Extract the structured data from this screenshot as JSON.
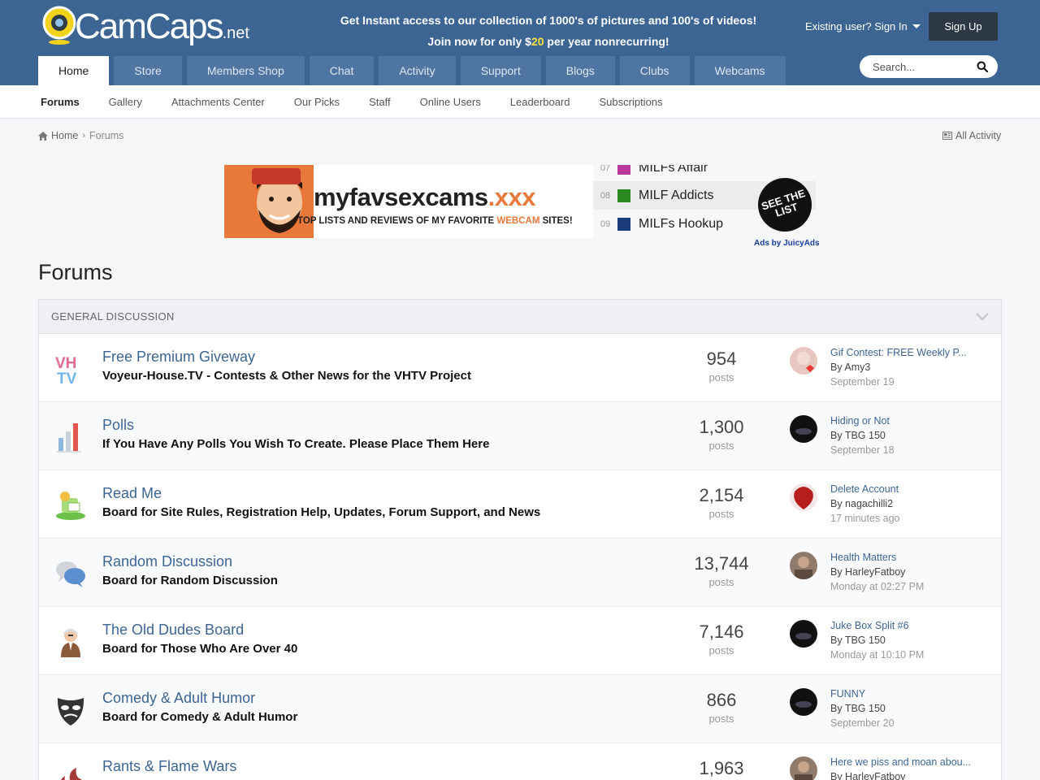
{
  "header": {
    "logo_main": "CamCaps",
    "logo_suffix": ".net",
    "promo_line1": "Get Instant access to our collection of 1000's of pictures and 100's of videos!",
    "promo_line2_pre": "Join now for only $",
    "promo_line2_price": "20",
    "promo_line2_post": " per year nonrecurring!",
    "signin_label": "Existing user? Sign In",
    "signup_label": "Sign Up",
    "search_placeholder": "Search..."
  },
  "nav": {
    "tabs": [
      {
        "label": "Home"
      },
      {
        "label": "Store"
      },
      {
        "label": "Members Shop"
      },
      {
        "label": "Chat"
      },
      {
        "label": "Activity"
      },
      {
        "label": "Support"
      },
      {
        "label": "Blogs"
      },
      {
        "label": "Clubs"
      },
      {
        "label": "Webcams"
      }
    ],
    "active_tab": "Home"
  },
  "subnav": {
    "items": [
      {
        "label": "Forums"
      },
      {
        "label": "Gallery"
      },
      {
        "label": "Attachments Center"
      },
      {
        "label": "Our Picks"
      },
      {
        "label": "Staff"
      },
      {
        "label": "Online Users"
      },
      {
        "label": "Leaderboard"
      },
      {
        "label": "Subscriptions"
      }
    ]
  },
  "breadcrumb": {
    "home": "Home",
    "current": "Forums",
    "all_activity": "All Activity"
  },
  "ad": {
    "brand_pre": "myfavsexcams",
    "brand_post": ".xxx",
    "tagline_pre": "TOP LISTS AND REVIEWS OF MY FAVORITE ",
    "tagline_hl": "WEBCAM",
    "tagline_post": " SITES!",
    "list": [
      {
        "num": "07",
        "name": "MILFs Affair",
        "color": "#b8399a"
      },
      {
        "num": "08",
        "name": "MILF Addicts",
        "color": "#2a8a1f"
      },
      {
        "num": "09",
        "name": "MILFs Hookup",
        "color": "#1a3a7a"
      }
    ],
    "badge": "SEE THE LIST",
    "credit": "Ads by JuicyAds"
  },
  "page_title": "Forums",
  "category": {
    "title": "GENERAL DISCUSSION"
  },
  "forums": [
    {
      "icon": "vhtv-icon",
      "title": "Free Premium Giveway",
      "desc": "Voyeur-House.TV - Contests & Other News for the VHTV Project",
      "count": "954",
      "count_label": "posts",
      "last_title": "Gif Contest: FREE Weekly P...",
      "last_by": "By Amy3",
      "last_date": "September 19",
      "avatar_color": "#e7c7c0"
    },
    {
      "icon": "poll-chart-icon",
      "title": "Polls",
      "desc": "If You Have Any Polls You Wish To Create. Please Place Them Here",
      "count": "1,300",
      "count_label": "posts",
      "last_title": "Hiding or Not",
      "last_by": "By TBG 150",
      "last_date": "September 18",
      "avatar_color": "#111111"
    },
    {
      "icon": "readme-icon",
      "title": "Read Me",
      "desc": "Board for Site Rules, Registration Help, Updates, Forum Support, and News",
      "count": "2,154",
      "count_label": "posts",
      "last_title": "Delete Account",
      "last_by": "By nagachilli2",
      "last_date": "17 minutes ago",
      "avatar_color": "#b81d1d"
    },
    {
      "icon": "chat-bubbles-icon",
      "title": "Random Discussion",
      "desc": "Board for Random Discussion",
      "count": "13,744",
      "count_label": "posts",
      "last_title": "Health Matters",
      "last_by": "By HarleyFatboy",
      "last_date": "Monday at 02:27 PM",
      "avatar_color": "#8f7a6b"
    },
    {
      "icon": "old-man-icon",
      "title": "The Old Dudes Board",
      "desc": "Board for Those Who Are Over 40",
      "count": "7,146",
      "count_label": "posts",
      "last_title": "Juke Box Split #6",
      "last_by": "By TBG 150",
      "last_date": "Monday at 10:10 PM",
      "avatar_color": "#111111"
    },
    {
      "icon": "mask-icon",
      "title": "Comedy & Adult Humor",
      "desc": "Board for Comedy & Adult Humor",
      "count": "866",
      "count_label": "posts",
      "last_title": "FUNNY",
      "last_by": "By TBG 150",
      "last_date": "September 20",
      "avatar_color": "#111111"
    },
    {
      "icon": "flame-wars-icon",
      "title": "Rants & Flame Wars",
      "desc": "",
      "count": "1,963",
      "count_label": "",
      "last_title": "Here we piss and moan abou...",
      "last_by": "By HarleyFatboy",
      "last_date": "",
      "avatar_color": "#8f7a6b"
    }
  ]
}
